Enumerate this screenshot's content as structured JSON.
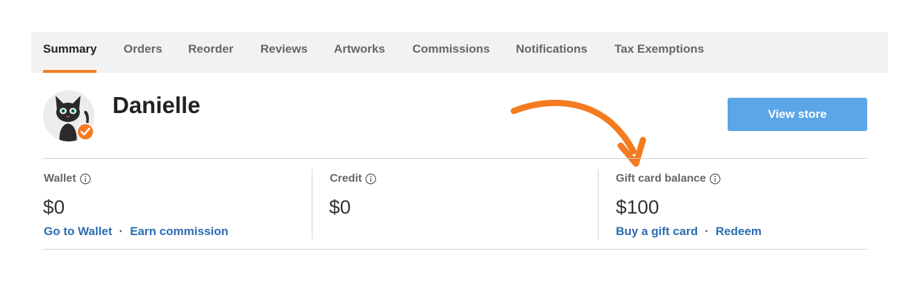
{
  "tabs": [
    {
      "label": "Summary",
      "active": true
    },
    {
      "label": "Orders",
      "active": false
    },
    {
      "label": "Reorder",
      "active": false
    },
    {
      "label": "Reviews",
      "active": false
    },
    {
      "label": "Artworks",
      "active": false
    },
    {
      "label": "Commissions",
      "active": false
    },
    {
      "label": "Notifications",
      "active": false
    },
    {
      "label": "Tax Exemptions",
      "active": false
    }
  ],
  "profile": {
    "name": "Danielle",
    "view_store_label": "View store"
  },
  "stats": {
    "wallet": {
      "label": "Wallet",
      "value": "$0",
      "link1": "Go to Wallet",
      "link2": "Earn commission"
    },
    "credit": {
      "label": "Credit",
      "value": "$0"
    },
    "gift_card": {
      "label": "Gift card balance",
      "value": "$100",
      "link1": "Buy a gift card",
      "link2": "Redeem"
    },
    "separator": "·"
  },
  "icons": {
    "info": "info-circle-icon",
    "verified": "verified-check-icon",
    "annotation": "curved-arrow-icon"
  },
  "colors": {
    "accent": "#f47b20",
    "button": "#5ba6e6",
    "link": "#2b6cb0"
  }
}
